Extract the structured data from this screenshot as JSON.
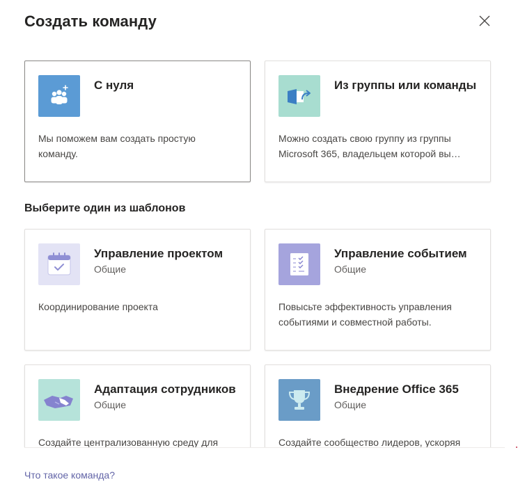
{
  "dialog": {
    "title": "Создать команду",
    "close_icon": "close-icon"
  },
  "start_options": [
    {
      "title": "С нуля",
      "description": "Мы поможем вам создать простую команду.",
      "icon": "people-add-icon",
      "icon_bg": "#5b9bd5"
    },
    {
      "title": "Из группы или команды",
      "description": "Можно создать свою группу из группы Microsoft 365, владельцем которой вы являетесь.",
      "icon": "group-export-icon",
      "icon_bg": "#a8ddd0"
    }
  ],
  "templates_heading": "Выберите один из шаблонов",
  "templates": [
    {
      "title": "Управление проектом",
      "category": "Общие",
      "description": "Координирование проекта",
      "icon": "calendar-check-icon",
      "icon_bg": "#e3e3f5"
    },
    {
      "title": "Управление событием",
      "category": "Общие",
      "description": "Повысьте эффективность управления событиями и совместной работы.",
      "icon": "checklist-icon",
      "icon_bg": "#a5a4dd"
    },
    {
      "title": "Адаптация сотрудников",
      "category": "Общие",
      "description": "Создайте централизованную среду для",
      "icon": "handshake-icon",
      "icon_bg": "#b6e3da"
    },
    {
      "title": "Внедрение Office 365",
      "category": "Общие",
      "description": "Создайте сообщество лидеров, ускоряя",
      "icon": "trophy-icon",
      "icon_bg": "#6a9cc7"
    }
  ],
  "footer": {
    "help_link": "Что такое команда?"
  },
  "colors": {
    "accent": "#6264a7",
    "selected_border": "#8a8886"
  }
}
